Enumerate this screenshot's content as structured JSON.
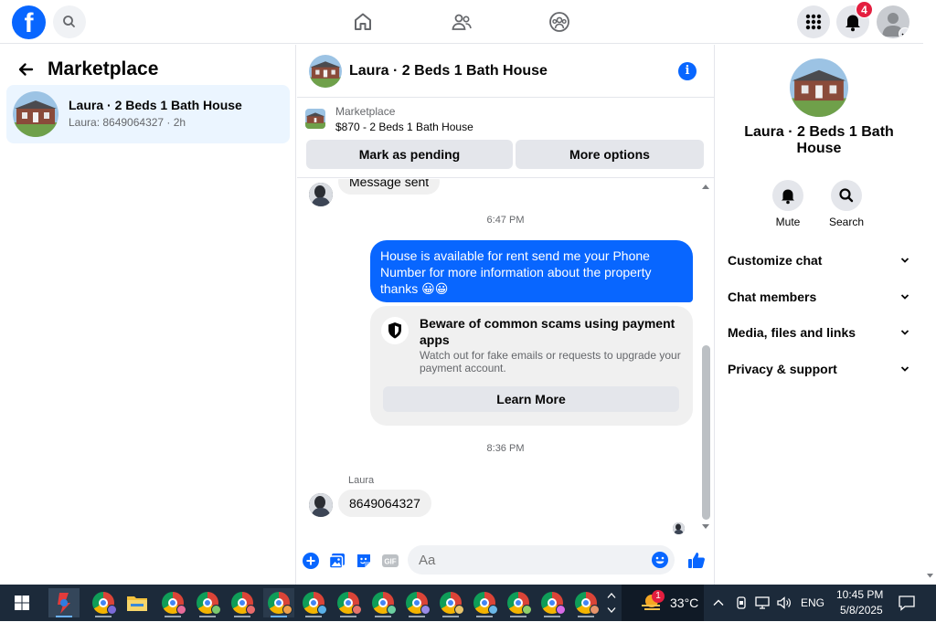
{
  "topbar": {
    "logo_letter": "f",
    "notification_count": "4",
    "colors": {
      "brand": "#0866ff",
      "badge": "#e41e3f"
    }
  },
  "left": {
    "title": "Marketplace",
    "conversation": {
      "title": "Laura · 2 Beds 1 Bath House",
      "subtitle": "Laura: 8649064327 · 2h"
    }
  },
  "chat": {
    "title": "Laura · 2 Beds 1 Bath House",
    "listing": {
      "label": "Marketplace",
      "price_title": "$870 - 2 Beds 1 Bath House",
      "pending_label": "Mark as pending",
      "more_label": "More options"
    },
    "messages": {
      "partial_in": "Message sent",
      "time1": "6:47 PM",
      "out_text": "House is available for rent send me your Phone Number for more information about the property thanks 😀😀",
      "scam_title": "Beware of common scams using payment apps",
      "scam_text": "Watch out for fake emails or requests to upgrade your payment account.",
      "learn_more": "Learn More",
      "time2": "8:36 PM",
      "sender": "Laura",
      "in_text": "8649064327"
    },
    "composer": {
      "placeholder": "Aa"
    }
  },
  "right": {
    "name": "Laura · 2 Beds 1 Bath House",
    "actions": [
      {
        "label": "Mute"
      },
      {
        "label": "Search"
      }
    ],
    "sections": [
      {
        "label": "Customize chat"
      },
      {
        "label": "Chat members"
      },
      {
        "label": "Media, files and links"
      },
      {
        "label": "Privacy & support"
      }
    ]
  },
  "taskbar": {
    "weather_badge": "1",
    "temperature": "33°C",
    "language": "ENG",
    "time": "10:45 PM",
    "date": "5/8/2025"
  }
}
